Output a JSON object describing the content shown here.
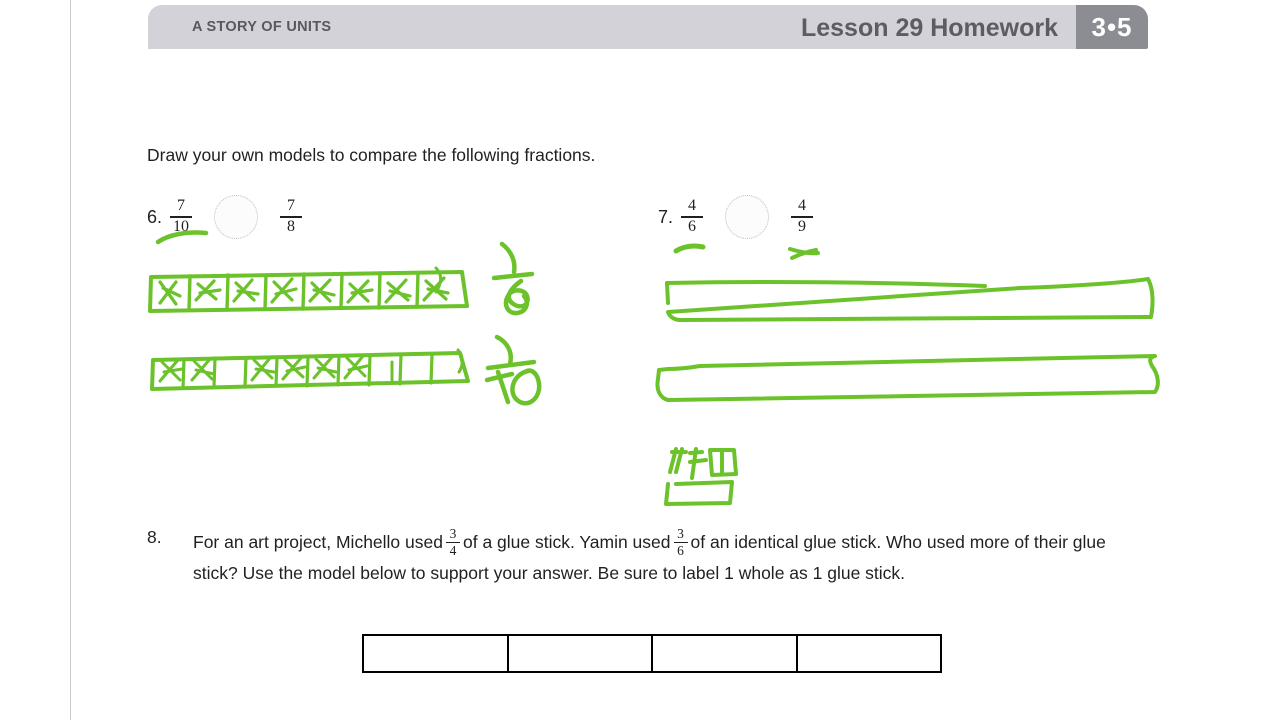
{
  "header": {
    "left_label": "A STORY OF UNITS",
    "title": "Lesson 29 Homework",
    "badge": "3•5",
    "band_color": "#d2d2d8",
    "badge_color": "#8c8c93",
    "text_color": "#5c5c64"
  },
  "instruction": "Draw your own models to compare the following fractions.",
  "problems": [
    {
      "number": "6.",
      "left_fraction": {
        "numerator": "7",
        "denominator": "10"
      },
      "operator_placeholder": "compare-circle",
      "right_fraction": {
        "numerator": "7",
        "denominator": "8"
      }
    },
    {
      "number": "7.",
      "left_fraction": {
        "numerator": "4",
        "denominator": "6"
      },
      "operator_placeholder": "compare-circle",
      "right_fraction": {
        "numerator": "4",
        "denominator": "9"
      }
    }
  ],
  "problem8": {
    "number": "8.",
    "text_part1": "For an art project, Michello used",
    "fraction1": {
      "numerator": "3",
      "denominator": "4"
    },
    "text_part2": "of a glue stick.  Yamin used",
    "fraction2": {
      "numerator": "3",
      "denominator": "6"
    },
    "text_part3": "of an identical glue stick.  Who used more of their glue stick?  Use the model below to support your answer.  Be sure to label 1 whole as 1 glue stick.",
    "tape_cells": [
      "",
      "",
      "",
      ""
    ]
  },
  "annotations": {
    "ink_color": "#6cc22b",
    "items": [
      {
        "name": "underline-7-10",
        "kind": "stroke"
      },
      {
        "name": "bar-model-eighths",
        "kind": "tape-diagram-scribbled"
      },
      {
        "name": "handwritten-fraction-7-8",
        "kind": "handwriting"
      },
      {
        "name": "bar-model-tenths",
        "kind": "tape-diagram-scribbled"
      },
      {
        "name": "handwritten-fraction-7-10",
        "kind": "handwriting"
      },
      {
        "name": "underline-4-6",
        "kind": "stroke"
      },
      {
        "name": "underline-4-9",
        "kind": "stroke"
      },
      {
        "name": "bar-model-sixths-blank",
        "kind": "tape-diagram-outline"
      },
      {
        "name": "bar-model-ninths-blank",
        "kind": "tape-diagram-outline"
      },
      {
        "name": "scribble-note",
        "kind": "handwriting"
      }
    ]
  }
}
